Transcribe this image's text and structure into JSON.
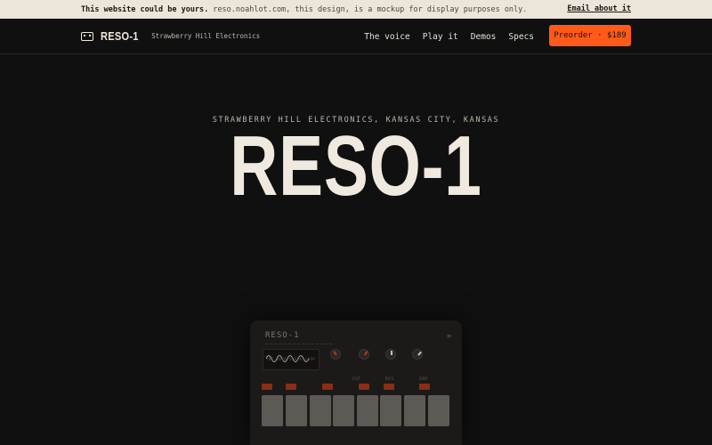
{
  "banner": {
    "lead": "This website could be yours.",
    "message": "reso.noahlot.com, this design, is a mockup for display purposes only.",
    "email_link": "Email about it"
  },
  "nav": {
    "brand_name": "RESO-1",
    "brand_sub": "Strawberry Hill Electronics",
    "links": [
      "The voice",
      "Play it",
      "Demos",
      "Specs"
    ],
    "cta": "Preorder · $189"
  },
  "hero": {
    "eyebrow": "STRAWBERRY HILL ELECTRONICS, KANSAS CITY, KANSAS",
    "title": "RESO-1"
  },
  "device": {
    "name": "RESO-1",
    "menu_glyph": "≡",
    "screen_text": "TRI WAVE SHAPE LOOP",
    "knob_labels": [
      "CUT",
      "RES",
      "ENV"
    ],
    "accent": "#ff5a1a",
    "key_color": "#5d5955"
  }
}
